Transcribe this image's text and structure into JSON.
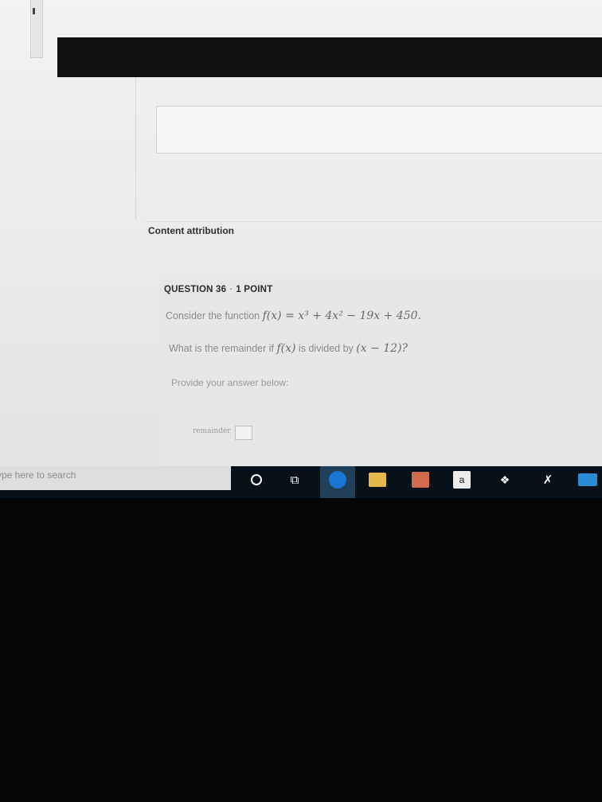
{
  "content": {
    "attribution_link": "Content attribution"
  },
  "question": {
    "number_label": "QUESTION 36",
    "points": "1 POINT",
    "line1_prefix": "Consider the function",
    "line1_math": "f(x) = x³ + 4x² − 19x + 450.",
    "line2_prefix": "What is the remainder if",
    "line2_math_f": "f(x)",
    "line2_middle": "is divided by",
    "line2_math_divisor": "(x − 12)?",
    "prompt": "Provide your answer below:",
    "answer_label": "remainder",
    "answer_value": ""
  },
  "taskbar": {
    "search_placeholder": "ype here to search",
    "icons": [
      "cortana-icon",
      "task-view-icon",
      "edge-icon",
      "file-explorer-icon",
      "store-icon",
      "amazon-icon",
      "dropbox-icon",
      "pen-icon",
      "mail-icon"
    ],
    "amazon_letter": "a"
  }
}
